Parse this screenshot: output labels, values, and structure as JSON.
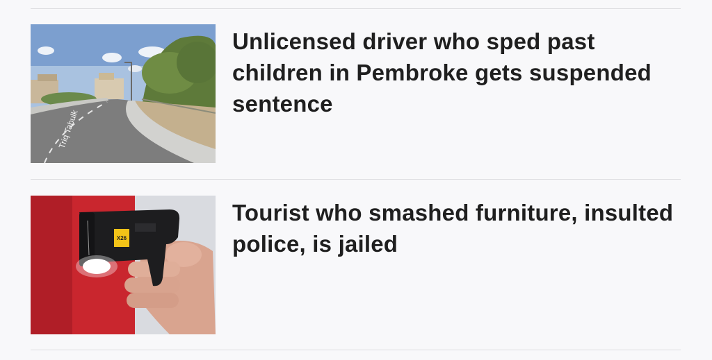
{
  "articles": [
    {
      "headline": "Unlicensed driver who sped past children in Pembroke gets suspended sentence",
      "image_alt": "Street view of a curved road in Pembroke",
      "road_sign_text": "Triq Tabulk"
    },
    {
      "headline": "Tourist who smashed furniture, insulted police, is jailed",
      "image_alt": "Hand holding a taser",
      "taser_label": "X26"
    }
  ]
}
